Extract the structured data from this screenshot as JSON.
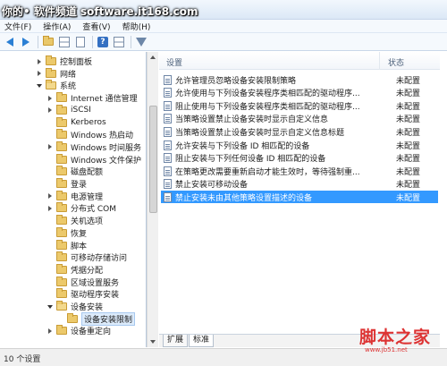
{
  "window": {
    "title": "你的• 软件频道 software.it168.com"
  },
  "menu": [
    "文件(F)",
    "操作(A)",
    "查看(V)",
    "帮助(H)"
  ],
  "toolbar": [
    "back-icon",
    "forward-icon",
    "folder-icon",
    "grid-icon",
    "export-icon",
    "help-icon",
    "properties-icon",
    "filter-icon"
  ],
  "tree": {
    "items": [
      {
        "label": "控制面板",
        "level": 1,
        "expanded": false
      },
      {
        "label": "网络",
        "level": 1,
        "expanded": false
      },
      {
        "label": "系统",
        "level": 1,
        "expanded": true
      },
      {
        "label": "Internet 通信管理",
        "level": 2,
        "expanded": false
      },
      {
        "label": "iSCSI",
        "level": 2,
        "expanded": false
      },
      {
        "label": "Kerberos",
        "level": 2,
        "expanded": null
      },
      {
        "label": "Windows 热启动",
        "level": 2,
        "expanded": null
      },
      {
        "label": "Windows 时间服务",
        "level": 2,
        "expanded": false
      },
      {
        "label": "Windows 文件保护",
        "level": 2,
        "expanded": null
      },
      {
        "label": "磁盘配额",
        "level": 2,
        "expanded": null
      },
      {
        "label": "登录",
        "level": 2,
        "expanded": null
      },
      {
        "label": "电源管理",
        "level": 2,
        "expanded": false
      },
      {
        "label": "分布式 COM",
        "level": 2,
        "expanded": false
      },
      {
        "label": "关机选项",
        "level": 2,
        "expanded": null
      },
      {
        "label": "恢复",
        "level": 2,
        "expanded": null
      },
      {
        "label": "脚本",
        "level": 2,
        "expanded": null
      },
      {
        "label": "可移动存储访问",
        "level": 2,
        "expanded": null
      },
      {
        "label": "凭据分配",
        "level": 2,
        "expanded": null
      },
      {
        "label": "区域设置服务",
        "level": 2,
        "expanded": null
      },
      {
        "label": "驱动程序安装",
        "level": 2,
        "expanded": null
      },
      {
        "label": "设备安装",
        "level": 2,
        "expanded": true
      },
      {
        "label": "设备安装限制",
        "level": 3,
        "expanded": null,
        "selected": true
      },
      {
        "label": "设备重定向",
        "level": 2,
        "expanded": false
      }
    ]
  },
  "list": {
    "col_name": "设置",
    "col_state": "状态",
    "rows": [
      {
        "name": "允许管理员忽略设备安装限制策略",
        "state": "未配置"
      },
      {
        "name": "允许使用与下列设备安装程序类相匹配的驱动程序...",
        "state": "未配置"
      },
      {
        "name": "阻止使用与下列设备安装程序类相匹配的驱动程序...",
        "state": "未配置"
      },
      {
        "name": "当策略设置禁止设备安装时显示自定义信息",
        "state": "未配置"
      },
      {
        "name": "当策略设置禁止设备安装时显示自定义信息标题",
        "state": "未配置"
      },
      {
        "name": "允许安装与下列设备 ID 相匹配的设备",
        "state": "未配置"
      },
      {
        "name": "阻止安装与下列任何设备 ID 相匹配的设备",
        "state": "未配置"
      },
      {
        "name": "在策略更改需要重新启动才能生效时，等待强制重...",
        "state": "未配置"
      },
      {
        "name": "禁止安装可移动设备",
        "state": "未配置"
      },
      {
        "name": "禁止安装未由其他策略设置描述的设备",
        "state": "未配置",
        "selected": true
      }
    ]
  },
  "tabs": [
    "扩展",
    "标准"
  ],
  "status": {
    "text": "10 个设置"
  },
  "watermark": {
    "cn": "脚本之家",
    "url": "www.jb51.net"
  }
}
